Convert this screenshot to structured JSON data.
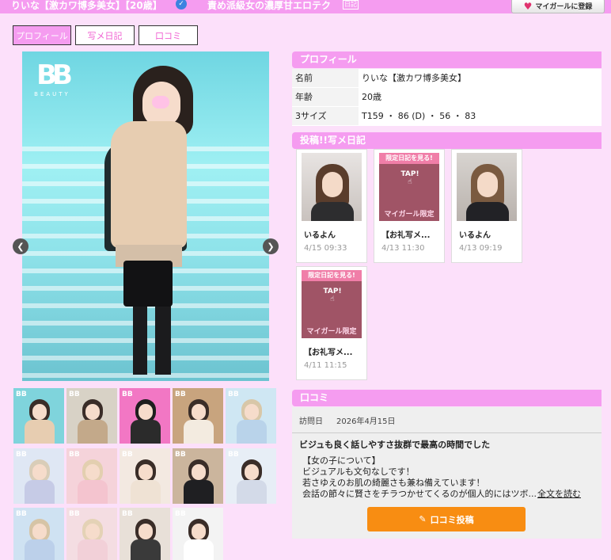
{
  "header": {
    "name": "りいな【激カワ博多美女】【20歳】",
    "catch": "責め派級女の濃厚甘エロテク",
    "diary_chip": "日記",
    "mygirl_button": "マイガールに登録",
    "verified_icon": "check-badge-icon",
    "bg_color": "#f59cf0"
  },
  "tabs": [
    {
      "label": "プロフィール",
      "active": true
    },
    {
      "label": "写メ日記",
      "active": false
    },
    {
      "label": "口コミ",
      "active": false
    }
  ],
  "gallery": {
    "logo_text": "BB",
    "logo_sub": "BEAUTY",
    "prev_icon": "chevron-left-icon",
    "next_icon": "chevron-right-icon"
  },
  "profile": {
    "section_title": "プロフィール",
    "rows": [
      {
        "label": "名前",
        "value": "りいな【激カワ博多美女】"
      },
      {
        "label": "年齢",
        "value": "20歳"
      },
      {
        "label": "3サイズ",
        "value": "T159 ・ 86 (D) ・ 56 ・ 83"
      }
    ]
  },
  "diary": {
    "section_title": "投稿!!写メ日記",
    "locked_top": "限定日記を見る!",
    "locked_tap": "TAP!",
    "locked_bottom": "マイガール限定",
    "cards": [
      {
        "title": "いるよん",
        "date": "4/15 09:33",
        "locked": false
      },
      {
        "title": "【お礼写メ...",
        "date": "4/13 11:30",
        "locked": true
      },
      {
        "title": "いるよん",
        "date": "4/13 09:19",
        "locked": false
      },
      {
        "title": "【お礼写メ...",
        "date": "4/11 11:15",
        "locked": true
      }
    ]
  },
  "review": {
    "section_title": "口コミ",
    "visit_label": "訪問日",
    "visit_date": "2026年4月15日",
    "title": "ビジュも良く話しやすさ抜群で最高の時間でした",
    "lines": [
      "【女の子について】",
      "ビジュアルも文句なしです！",
      "若さゆえのお肌の綺麗さも兼ね備えています！",
      "会話の節々に賢さをチラつかせてくるのが個人的にはツボ..."
    ],
    "read_more": "全文を読む",
    "post_button": "口コミ投稿",
    "post_icon": "pencil-icon",
    "button_color": "#f88d12"
  }
}
